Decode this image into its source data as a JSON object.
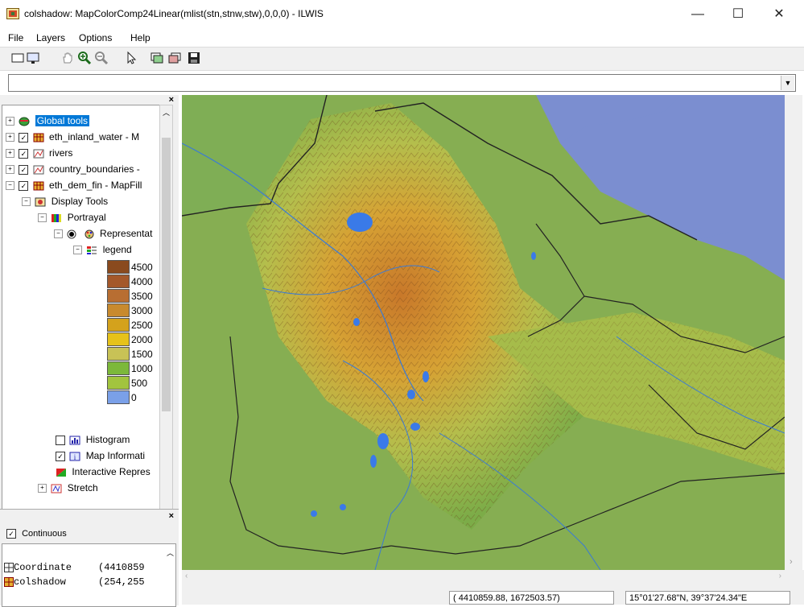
{
  "window": {
    "title": "colshadow: MapColorComp24Linear(mlist(stn,stnw,stw),0,0,0) - ILWIS",
    "minimize": "—",
    "maximize": "☐",
    "close": "✕"
  },
  "menu": {
    "file": "File",
    "layers": "Layers",
    "options": "Options",
    "help": "Help"
  },
  "toolbar": {
    "icons": [
      "new-icon",
      "display-icon",
      "pan-icon",
      "zoom-in-icon",
      "zoom-out-icon",
      "select-icon",
      "layer-up-icon",
      "layer-down-icon",
      "save-icon"
    ]
  },
  "combo": {
    "value": "",
    "arrow": "▼"
  },
  "tree": {
    "global_tools": "Global tools",
    "layer1": "eth_inland_water - M",
    "layer2": "rivers",
    "layer3": "country_boundaries -",
    "layer4": "eth_dem_fin - MapFill",
    "display_tools": "Display Tools",
    "portrayal": "Portrayal",
    "representation": "Representat",
    "legend": "legend",
    "histogram": "Histogram",
    "map_information": "Map Informati",
    "interactive": "Interactive Repres",
    "stretch": "Stretch"
  },
  "legend": [
    {
      "value": "4500",
      "color": "#8a4a1e"
    },
    {
      "value": "4000",
      "color": "#a4582a"
    },
    {
      "value": "3500",
      "color": "#b86e32"
    },
    {
      "value": "3000",
      "color": "#c88a2e"
    },
    {
      "value": "2500",
      "color": "#d4a21c"
    },
    {
      "value": "2000",
      "color": "#e6c21a"
    },
    {
      "value": "1500",
      "color": "#c8c256"
    },
    {
      "value": "1000",
      "color": "#7cb83a"
    },
    {
      "value": "500",
      "color": "#a2c43e"
    },
    {
      "value": "0",
      "color": "#7aa0e8"
    }
  ],
  "bottom": {
    "continuous": "Continuous",
    "rows": [
      {
        "name": "Coordinate",
        "value": "(4410859"
      },
      {
        "name": "colshadow",
        "value": "(254,255"
      }
    ]
  },
  "status": {
    "coords": "( 4410859.88,  1672503.57)",
    "latlon": "15°01'27.68\"N, 39°37'24.34\"E"
  }
}
